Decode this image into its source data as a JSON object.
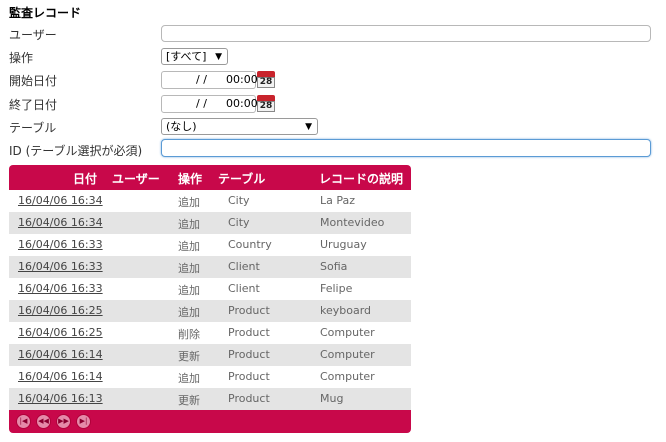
{
  "title": "監査レコード",
  "form": {
    "user_label": "ユーザー",
    "user_value": "",
    "op_label": "操作",
    "op_value": "[すべて]",
    "start_label": "開始日付",
    "start_date": "/ /",
    "start_time": "00:00",
    "end_label": "終了日付",
    "end_date": "/ /",
    "end_time": "00:00",
    "table_label": "テーブル",
    "table_value": "(なし)",
    "id_label": "ID (テーブル選択が必須)",
    "id_value": "",
    "calendar_day": "28"
  },
  "grid": {
    "headers": {
      "date": "日付",
      "user": "ユーザー",
      "op": "操作",
      "table": "テーブル",
      "desc": "レコードの説明"
    },
    "rows": [
      {
        "date": "16/04/06 16:34",
        "user": "",
        "op": "追加",
        "table": "City",
        "desc": "La Paz"
      },
      {
        "date": "16/04/06 16:34",
        "user": "",
        "op": "追加",
        "table": "City",
        "desc": "Montevideo"
      },
      {
        "date": "16/04/06 16:33",
        "user": "",
        "op": "追加",
        "table": "Country",
        "desc": "Uruguay"
      },
      {
        "date": "16/04/06 16:33",
        "user": "",
        "op": "追加",
        "table": "Client",
        "desc": "Sofia"
      },
      {
        "date": "16/04/06 16:33",
        "user": "",
        "op": "追加",
        "table": "Client",
        "desc": "Felipe"
      },
      {
        "date": "16/04/06 16:25",
        "user": "",
        "op": "追加",
        "table": "Product",
        "desc": "keyboard"
      },
      {
        "date": "16/04/06 16:25",
        "user": "",
        "op": "削除",
        "table": "Product",
        "desc": "Computer"
      },
      {
        "date": "16/04/06 16:14",
        "user": "",
        "op": "更新",
        "table": "Product",
        "desc": "Computer"
      },
      {
        "date": "16/04/06 16:14",
        "user": "",
        "op": "追加",
        "table": "Product",
        "desc": "Computer"
      },
      {
        "date": "16/04/06 16:13",
        "user": "",
        "op": "更新",
        "table": "Product",
        "desc": "Mug"
      }
    ],
    "pager": {
      "first": "|◀",
      "prev": "◀◀",
      "next": "▶▶",
      "last": "▶|"
    }
  },
  "colors": {
    "accent": "#c8084a",
    "alt_row": "#e4e4e4"
  },
  "icons": {
    "calendar": "calendar-icon",
    "dropdown": "chevron-down-icon"
  }
}
